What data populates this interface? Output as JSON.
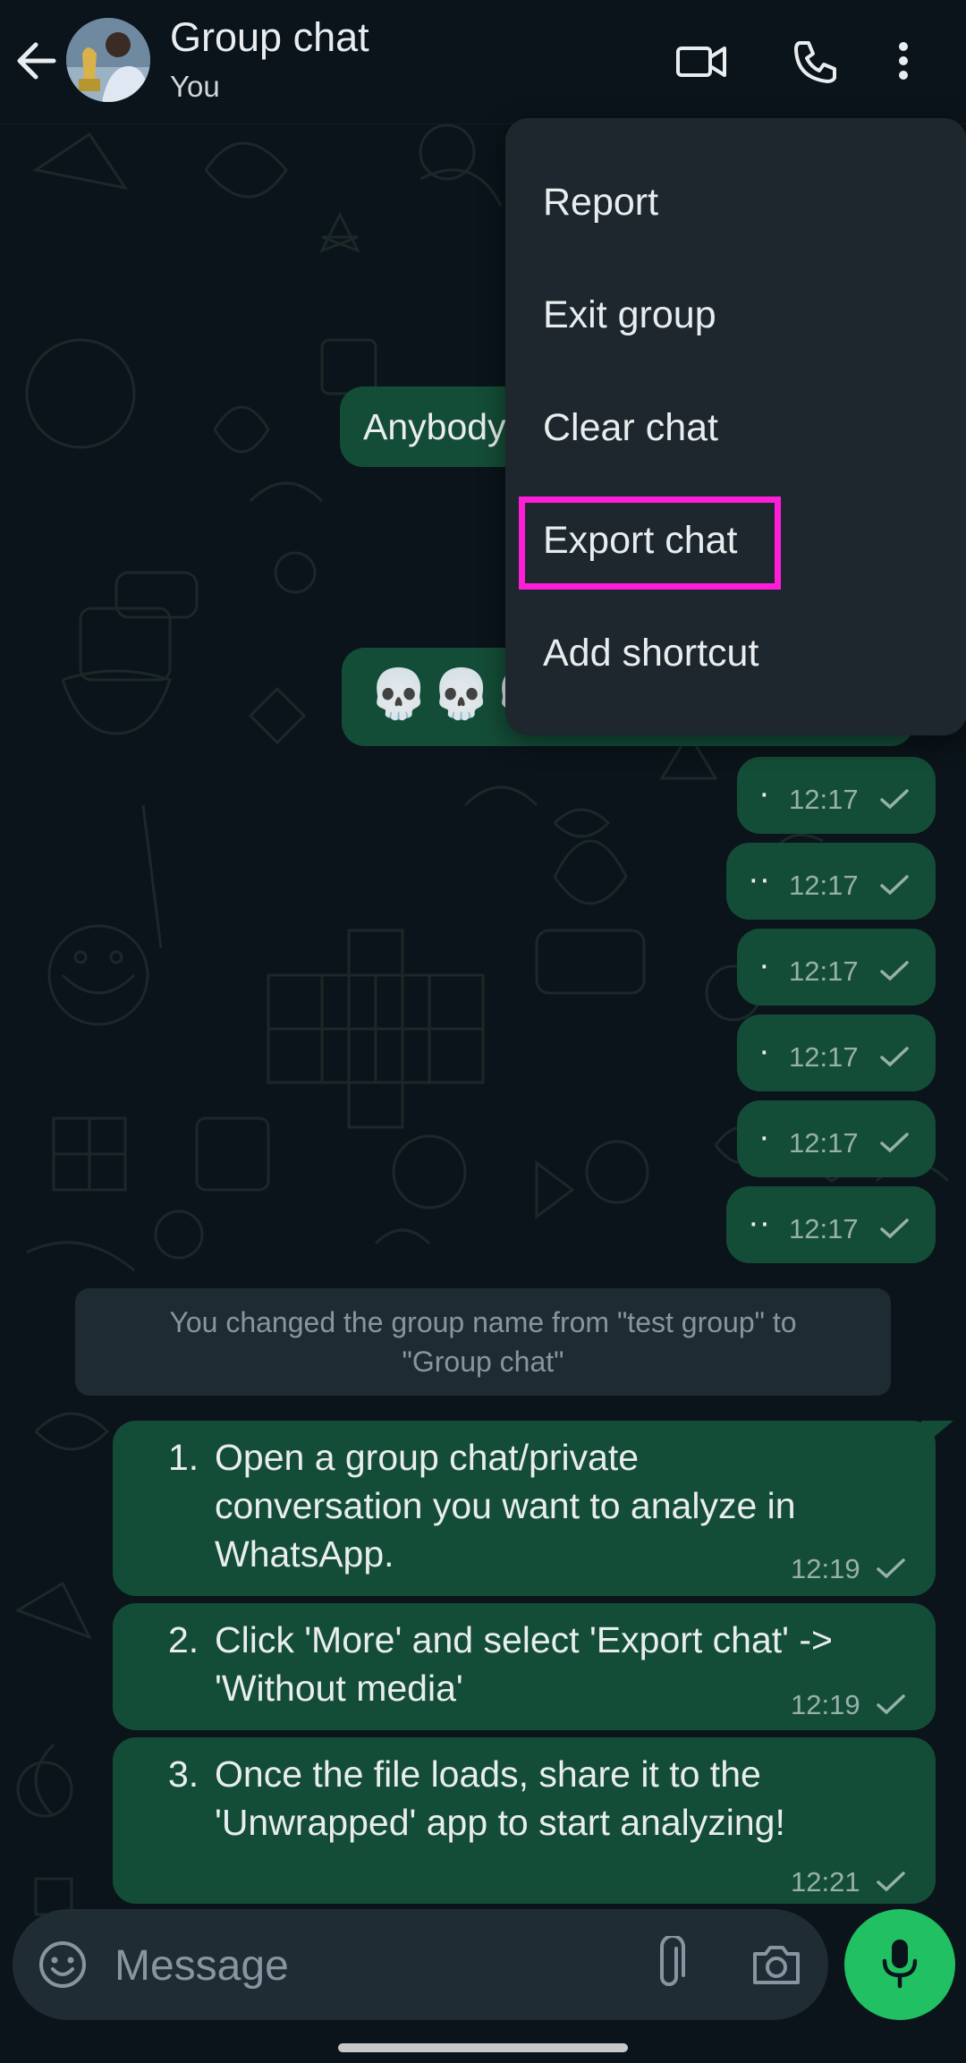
{
  "header": {
    "title": "Group chat",
    "subtitle": "You",
    "icons": [
      "back-arrow-icon",
      "video-call-icon",
      "voice-call-icon",
      "more-options-icon"
    ]
  },
  "menu": {
    "items": [
      "Report",
      "Exit group",
      "Clear chat",
      "Export chat",
      "Add shortcut"
    ],
    "highlighted": "Export chat"
  },
  "messages": {
    "partial_text": "Anybody",
    "skulls": [
      "💀",
      "💀",
      "💀"
    ],
    "dots": [
      {
        "text": "·",
        "time": "12:17"
      },
      {
        "text": "··",
        "time": "12:17"
      },
      {
        "text": "·",
        "time": "12:17"
      },
      {
        "text": "·",
        "time": "12:17"
      },
      {
        "text": "·",
        "time": "12:17"
      },
      {
        "text": "··",
        "time": "12:17"
      }
    ],
    "system": {
      "line1": "You changed the group name from \"test group\" to",
      "line2": "\"Group chat\""
    },
    "steps": [
      {
        "num": "1.",
        "lines": [
          "Open a group chat/private",
          "conversation you want to analyze in",
          "WhatsApp."
        ],
        "time": "12:19"
      },
      {
        "num": "2.",
        "lines": [
          "Click 'More' and select 'Export chat' ->",
          "'Without media'"
        ],
        "time": "12:19"
      },
      {
        "num": "3.",
        "lines": [
          "Once the file loads, share it to the",
          "'Unwrapped' app to start analyzing!"
        ],
        "time": "12:21"
      }
    ]
  },
  "input": {
    "placeholder": "Message"
  },
  "colors": {
    "background": "#0b141a",
    "outgoing_bubble": "#144d37",
    "menu_bg": "#1e272d",
    "highlight": "#ff1ed8",
    "mic_button": "#21c063"
  }
}
